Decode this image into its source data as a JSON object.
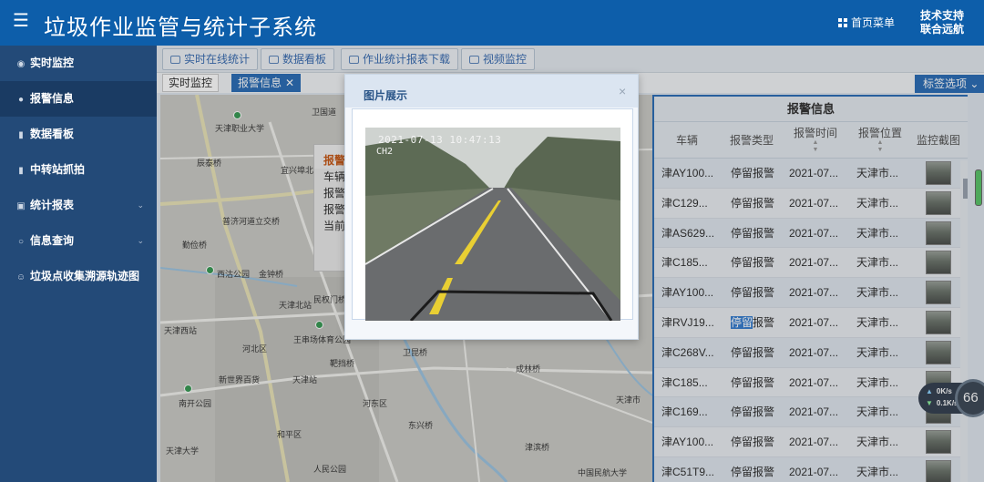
{
  "header": {
    "title": "垃圾作业监管与统计子系统",
    "home_menu_label": "首页菜单",
    "support_line1": "技术支持",
    "support_line2": "联合远航"
  },
  "sidebar": {
    "items": [
      {
        "label": "实时监控",
        "icon": "location-icon",
        "active": false
      },
      {
        "label": "报警信息",
        "icon": "bulb-icon",
        "active": true
      },
      {
        "label": "数据看板",
        "icon": "bar-chart-icon",
        "active": false
      },
      {
        "label": "中转站抓拍",
        "icon": "bar-chart-icon",
        "active": false
      },
      {
        "label": "统计报表",
        "icon": "clipboard-icon",
        "active": false,
        "expandable": true
      },
      {
        "label": "信息查询",
        "icon": "circle-icon",
        "active": false,
        "expandable": true
      },
      {
        "label": "垃圾点收集溯源轨迹图",
        "icon": "user-icon",
        "active": false
      }
    ]
  },
  "toolbar": {
    "buttons": [
      "实时在线统计",
      "数据看板",
      "作业统计报表下载",
      "视频监控"
    ]
  },
  "tabs": [
    {
      "label": "实时监控",
      "active": false
    },
    {
      "label": "报警信息",
      "active": true
    }
  ],
  "tag_options": "标签选项",
  "map": {
    "labels": [
      "天津职业大学",
      "辰泰桥",
      "宜兴埠北",
      "普济河道立交桥",
      "勤俭桥",
      "西沽公园",
      "金钟桥",
      "天津北站",
      "民权门桥",
      "天津西站",
      "王串场体育公园",
      "河北区",
      "卫昆桥",
      "天津站",
      "新世界百货",
      "靶挡桥",
      "成林桥",
      "南开公园",
      "河东区",
      "东兴桥",
      "天津大学",
      "和平区",
      "人民公园",
      "津滨桥",
      "中国民航大学",
      "天津市",
      "卫国道"
    ],
    "popup": {
      "title": "报警",
      "rows": [
        "车辆",
        "报警",
        "报警",
        "当前"
      ]
    }
  },
  "modal": {
    "title": "图片展示",
    "close": "×",
    "photo_timestamp": "2021-07-13 10:47:13",
    "photo_channel": "CH2"
  },
  "alarm_list": {
    "title": "报警信息",
    "columns": [
      "车辆",
      "报警类型",
      "报警时间",
      "报警位置",
      "监控截图"
    ],
    "rows": [
      {
        "vehicle": "津AY100...",
        "type": "停留报警",
        "time": "2021-07...",
        "location": "天津市..."
      },
      {
        "vehicle": "津C129...",
        "type": "停留报警",
        "time": "2021-07...",
        "location": "天津市..."
      },
      {
        "vehicle": "津AS629...",
        "type": "停留报警",
        "time": "2021-07...",
        "location": "天津市..."
      },
      {
        "vehicle": "津C185...",
        "type": "停留报警",
        "time": "2021-07...",
        "location": "天津市..."
      },
      {
        "vehicle": "津AY100...",
        "type": "停留报警",
        "time": "2021-07...",
        "location": "天津市..."
      },
      {
        "vehicle": "津RVJ19...",
        "type": "停留报警",
        "time": "2021-07...",
        "location": "天津市...",
        "highlight": "停留"
      },
      {
        "vehicle": "津C268V...",
        "type": "停留报警",
        "time": "2021-07...",
        "location": "天津市..."
      },
      {
        "vehicle": "津C185...",
        "type": "停留报警",
        "time": "2021-07...",
        "location": "天津市..."
      },
      {
        "vehicle": "津C169...",
        "type": "停留报警",
        "time": "2021-07...",
        "location": "天津市..."
      },
      {
        "vehicle": "津AY100...",
        "type": "停留报警",
        "time": "2021-07...",
        "location": "天津市..."
      },
      {
        "vehicle": "津C51T9...",
        "type": "停留报警",
        "time": "2021-07...",
        "location": "天津市..."
      }
    ]
  },
  "net_widget": {
    "up": "0K/s",
    "down": "0.1K/s",
    "percent": "66"
  },
  "colors": {
    "header": "#0d5eaa",
    "sidebar": "#234a78",
    "sidebar_active": "#1a3b63",
    "accent": "#2e6fb7"
  }
}
